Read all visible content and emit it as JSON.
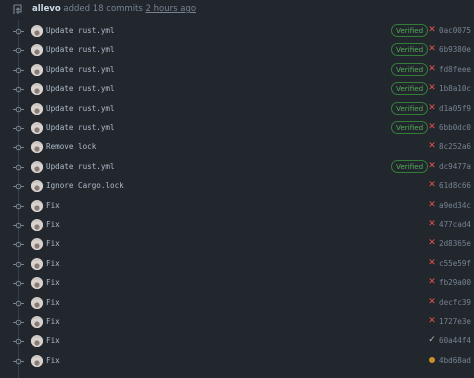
{
  "header": {
    "actor": "allevo",
    "action": "added 18 commits",
    "time": "2 hours ago"
  },
  "badge_label": "Verified",
  "colors": {
    "background": "#22272e",
    "fail": "#e5534b",
    "success": "#57ab5a",
    "pending": "#c69026"
  },
  "commits": [
    {
      "message": "Update rust.yml",
      "verified": true,
      "status": "fail",
      "status_icon": "x-icon",
      "sha": "0ac0075"
    },
    {
      "message": "Update rust.yml",
      "verified": true,
      "status": "fail",
      "status_icon": "x-icon",
      "sha": "6b9380e"
    },
    {
      "message": "Update rust.yml",
      "verified": true,
      "status": "fail",
      "status_icon": "x-icon",
      "sha": "fd8feee"
    },
    {
      "message": "Update rust.yml",
      "verified": true,
      "status": "fail",
      "status_icon": "x-icon",
      "sha": "1b8a10c"
    },
    {
      "message": "Update rust.yml",
      "verified": true,
      "status": "fail",
      "status_icon": "x-icon",
      "sha": "d1a05f9"
    },
    {
      "message": "Update rust.yml",
      "verified": true,
      "status": "fail",
      "status_icon": "x-icon",
      "sha": "6bb0dc0"
    },
    {
      "message": "Remove lock",
      "verified": false,
      "status": "fail",
      "status_icon": "x-icon",
      "sha": "8c252a6"
    },
    {
      "message": "Update rust.yml",
      "verified": true,
      "status": "fail",
      "status_icon": "x-icon",
      "sha": "dc9477a"
    },
    {
      "message": "Ignore Cargo.lock",
      "verified": false,
      "status": "fail",
      "status_icon": "x-icon",
      "sha": "61d8c66"
    },
    {
      "message": "Fix",
      "verified": false,
      "status": "fail",
      "status_icon": "x-icon",
      "sha": "a9ed34c"
    },
    {
      "message": "Fix",
      "verified": false,
      "status": "fail",
      "status_icon": "x-icon",
      "sha": "477cad4"
    },
    {
      "message": "Fix",
      "verified": false,
      "status": "fail",
      "status_icon": "x-icon",
      "sha": "2d8365e"
    },
    {
      "message": "Fix",
      "verified": false,
      "status": "fail",
      "status_icon": "x-icon",
      "sha": "c55e59f"
    },
    {
      "message": "Fix",
      "verified": false,
      "status": "fail",
      "status_icon": "x-icon",
      "sha": "fb29a00"
    },
    {
      "message": "Fix",
      "verified": false,
      "status": "fail",
      "status_icon": "x-icon",
      "sha": "decfc39"
    },
    {
      "message": "Fix",
      "verified": false,
      "status": "fail",
      "status_icon": "x-icon",
      "sha": "1727e3e"
    },
    {
      "message": "Fix",
      "verified": false,
      "status": "success",
      "status_icon": "check-icon",
      "sha": "60a44f4"
    },
    {
      "message": "Fix",
      "verified": false,
      "status": "pending",
      "status_icon": "dot-icon",
      "sha": "4bd68ad"
    }
  ]
}
